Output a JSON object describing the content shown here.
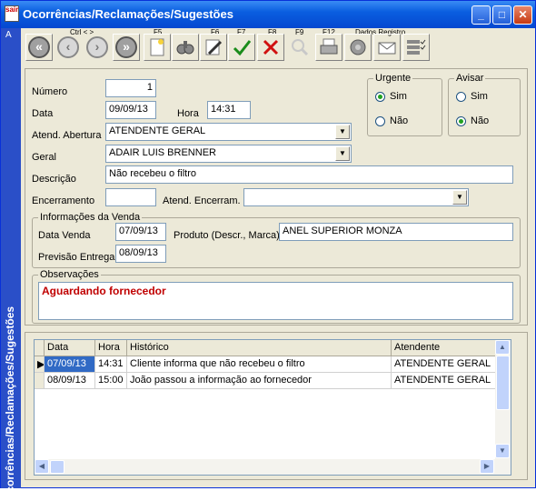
{
  "window": {
    "title": "Ocorrências/Reclamações/Sugestões",
    "icon_label": "sair",
    "sidebar_text": "Ocorrências/Reclamações/Sugestões",
    "sidebar_letter": "A"
  },
  "toolbar": {
    "keys": {
      "ctrl": "Ctrl < >",
      "f5": "F5",
      "f6": "F6",
      "f7": "F7",
      "f8": "F8",
      "f9": "F9",
      "f12": "F12",
      "dados_registro": "Dados  Registro"
    },
    "icons": [
      "first-icon",
      "previous-icon",
      "next-icon",
      "last-icon",
      "new-icon",
      "search-binoculars-icon",
      "edit-icon",
      "confirm-icon",
      "cancel-icon",
      "find-icon",
      "print-icon",
      "data-icon",
      "mail-icon",
      "list-icon"
    ]
  },
  "form": {
    "numero_label": "Número",
    "numero": "1",
    "data_label": "Data",
    "data": "09/09/13",
    "hora_label": "Hora",
    "hora": "14:31",
    "atend_abertura_label": "Atend. Abertura",
    "atend_abertura": "ATENDENTE GERAL",
    "geral_label": "Geral",
    "geral": "ADAIR LUIS BRENNER",
    "descricao_label": "Descrição",
    "descricao": "Não recebeu o filtro",
    "encerramento_label": "Encerramento",
    "encerramento": "",
    "atend_encerram_label": "Atend. Encerram.",
    "atend_encerram": ""
  },
  "urgente": {
    "title": "Urgente",
    "sim": "Sim",
    "nao": "Não",
    "selected": "sim"
  },
  "avisar": {
    "title": "Avisar",
    "sim": "Sim",
    "nao": "Não",
    "selected": "nao"
  },
  "venda": {
    "title": "Informações da Venda",
    "data_venda_label": "Data Venda",
    "data_venda": "07/09/13",
    "produto_label": "Produto (Descr., Marca)",
    "produto": "ANEL SUPERIOR MONZA",
    "previsao_label": "Previsão Entrega",
    "previsao": "08/09/13"
  },
  "observacoes": {
    "title": "Observações",
    "text": "Aguardando fornecedor"
  },
  "historico": {
    "columns": [
      "Data",
      "Hora",
      "Histórico",
      "Atendente"
    ],
    "rows": [
      [
        "07/09/13",
        "14:31",
        "Cliente informa que não recebeu o filtro",
        "ATENDENTE GERAL"
      ],
      [
        "08/09/13",
        "15:00",
        "João passou a informação ao fornecedor",
        "ATENDENTE GERAL"
      ]
    ]
  }
}
